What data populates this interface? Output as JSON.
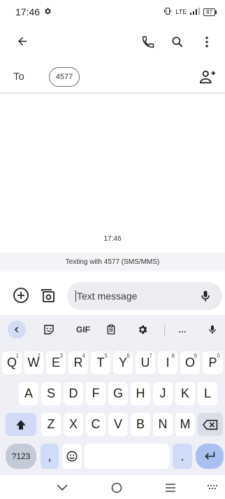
{
  "status_bar": {
    "time": "17:46",
    "network_text": "LTE",
    "battery": "87"
  },
  "recipient": {
    "to_label": "To",
    "chip_number": "4577"
  },
  "conversation": {
    "timestamp": "17:46",
    "info_text": "Texting with 4577 (SMS/MMS)"
  },
  "compose": {
    "placeholder": "Text message"
  },
  "keyboard": {
    "toolbar": {
      "gif_label": "GIF",
      "more_label": "…"
    },
    "row1": [
      {
        "label": "Q",
        "sup": "1"
      },
      {
        "label": "W",
        "sup": "2"
      },
      {
        "label": "E",
        "sup": "3"
      },
      {
        "label": "R",
        "sup": "4"
      },
      {
        "label": "T",
        "sup": "5"
      },
      {
        "label": "Y",
        "sup": "6"
      },
      {
        "label": "U",
        "sup": "7"
      },
      {
        "label": "I",
        "sup": "8"
      },
      {
        "label": "O",
        "sup": "9"
      },
      {
        "label": "P",
        "sup": "0"
      }
    ],
    "row2": [
      "A",
      "S",
      "D",
      "F",
      "G",
      "H",
      "J",
      "K",
      "L"
    ],
    "row3": [
      "Z",
      "X",
      "C",
      "V",
      "B",
      "N",
      "M"
    ],
    "symbols_label": "?123",
    "comma_label": ",",
    "period_label": "."
  },
  "icons": {
    "status": "gear-icon",
    "back": "arrow-left-icon",
    "call": "phone-icon",
    "search": "search-icon",
    "menu": "more-vertical-icon",
    "add_contact": "person-add-icon",
    "attach": "plus-circle-icon",
    "gallery": "camera-gallery-icon",
    "mic": "mic-icon"
  }
}
